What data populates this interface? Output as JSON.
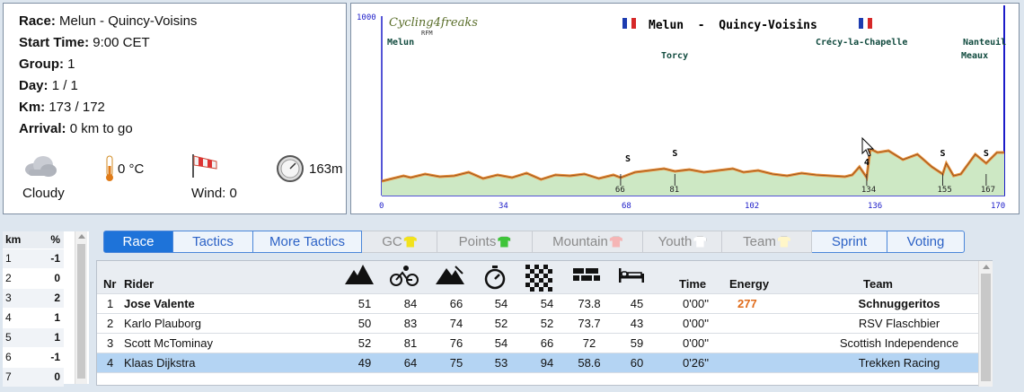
{
  "race_info": {
    "race_label": "Race:",
    "race_value": "Melun - Quincy-Voisins",
    "start_label": "Start Time:",
    "start_value": "9:00 CET",
    "group_label": "Group:",
    "group_value": "1",
    "day_label": "Day:",
    "day_value": "1 / 1",
    "km_label": "Km:",
    "km_value": "173 / 172",
    "arrival_label": "Arrival:",
    "arrival_value": "0 km to go",
    "weather": "Cloudy",
    "temperature": "0 °C",
    "wind": "Wind: 0",
    "altitude": "163m"
  },
  "profile": {
    "title": "Melun  -  Quincy-Voisins",
    "logo": "Cycling4freaks",
    "logo_sub": "RFM",
    "y_max_label": "1000",
    "places": [
      {
        "name": "Melun"
      },
      {
        "name": "Torcy"
      },
      {
        "name": "Crécy-la-Chapelle"
      },
      {
        "name": "Nanteuil"
      },
      {
        "name": "Meaux"
      }
    ],
    "x_ticks": [
      "0",
      "34",
      "68",
      "102",
      "136",
      "170"
    ],
    "x_range": [
      0,
      172
    ],
    "y_range": [
      0,
      1000
    ],
    "elevation_km": [
      0,
      3,
      6,
      8,
      12,
      16,
      20,
      24,
      28,
      32,
      36,
      40,
      44,
      48,
      52,
      56,
      60,
      64,
      66,
      70,
      74,
      78,
      81,
      85,
      89,
      93,
      97,
      100,
      104,
      108,
      112,
      116,
      120,
      124,
      128,
      130,
      132,
      134,
      135,
      137,
      140,
      144,
      148,
      152,
      155,
      156,
      158,
      160,
      164,
      167,
      170,
      172
    ],
    "elevation_m": [
      80,
      95,
      110,
      100,
      120,
      105,
      110,
      130,
      95,
      115,
      100,
      125,
      90,
      115,
      110,
      120,
      95,
      115,
      100,
      130,
      140,
      150,
      135,
      145,
      130,
      140,
      150,
      130,
      140,
      120,
      110,
      125,
      115,
      110,
      105,
      115,
      160,
      100,
      260,
      240,
      250,
      200,
      230,
      160,
      120,
      180,
      110,
      120,
      230,
      180,
      240,
      240
    ],
    "sprints": [
      {
        "label": "S",
        "km": 68
      },
      {
        "label": "S",
        "km": 81
      },
      {
        "label": "S",
        "km": 155
      },
      {
        "label": "S",
        "km": 167
      }
    ],
    "climbs": [
      {
        "label": "4",
        "km": 134
      }
    ],
    "markers": [
      "66",
      "81",
      "134",
      "155",
      "167"
    ],
    "accent_color": "#1b1bc8",
    "fill_color": "#cde8c4",
    "edge_color": "#e8903a"
  },
  "km_table": {
    "headers": [
      "km",
      "%"
    ],
    "rows": [
      {
        "km": "1",
        "p": "-1"
      },
      {
        "km": "2",
        "p": "0"
      },
      {
        "km": "3",
        "p": "2"
      },
      {
        "km": "4",
        "p": "1"
      },
      {
        "km": "5",
        "p": "1"
      },
      {
        "km": "6",
        "p": "-1"
      },
      {
        "km": "7",
        "p": "0"
      }
    ]
  },
  "tabs": [
    {
      "label": "Race",
      "active": true
    },
    {
      "label": "Tactics"
    },
    {
      "label": "More Tactics"
    },
    {
      "label": "GC",
      "shirt": "#f2e21c",
      "disabled": true
    },
    {
      "label": "Points",
      "shirt": "#3fc43a",
      "disabled": true
    },
    {
      "label": "Mountain",
      "shirt": "#f5b5b5",
      "disabled": true
    },
    {
      "label": "Youth",
      "shirt": "#ffffff",
      "disabled": true
    },
    {
      "label": "Team",
      "shirt": "#fff6c8",
      "disabled": true
    },
    {
      "label": "Sprint"
    },
    {
      "label": "Voting"
    }
  ],
  "rider_table": {
    "headers": {
      "nr": "Nr",
      "rider": "Rider",
      "time": "Time",
      "energy": "Energy",
      "team": "Team"
    },
    "stat_icons": [
      "mountain-icon",
      "cycling-icon",
      "hill-icon",
      "stopwatch-icon",
      "checkered-flag-icon",
      "cobblestone-icon",
      "bed-icon"
    ],
    "rows": [
      {
        "nr": "1",
        "rider": "Jose Valente",
        "s": [
          "51",
          "84",
          "66",
          "54",
          "54",
          "73.8",
          "45"
        ],
        "time": "0'00''",
        "energy": "277",
        "team": "Schnuggeritos",
        "bold": true
      },
      {
        "nr": "2",
        "rider": "Karlo Plauborg",
        "s": [
          "50",
          "83",
          "74",
          "52",
          "52",
          "73.7",
          "43"
        ],
        "time": "0'00''",
        "energy": "",
        "team": "RSV Flaschbier"
      },
      {
        "nr": "3",
        "rider": "Scott McTominay",
        "s": [
          "52",
          "81",
          "76",
          "54",
          "66",
          "72",
          "59"
        ],
        "time": "0'00''",
        "energy": "",
        "team": "Scottish Independence"
      },
      {
        "nr": "4",
        "rider": "Klaas Dijkstra",
        "s": [
          "49",
          "64",
          "75",
          "53",
          "94",
          "58.6",
          "60"
        ],
        "time": "0'26''",
        "energy": "",
        "team": "Trekken Racing",
        "selected": true
      }
    ]
  }
}
